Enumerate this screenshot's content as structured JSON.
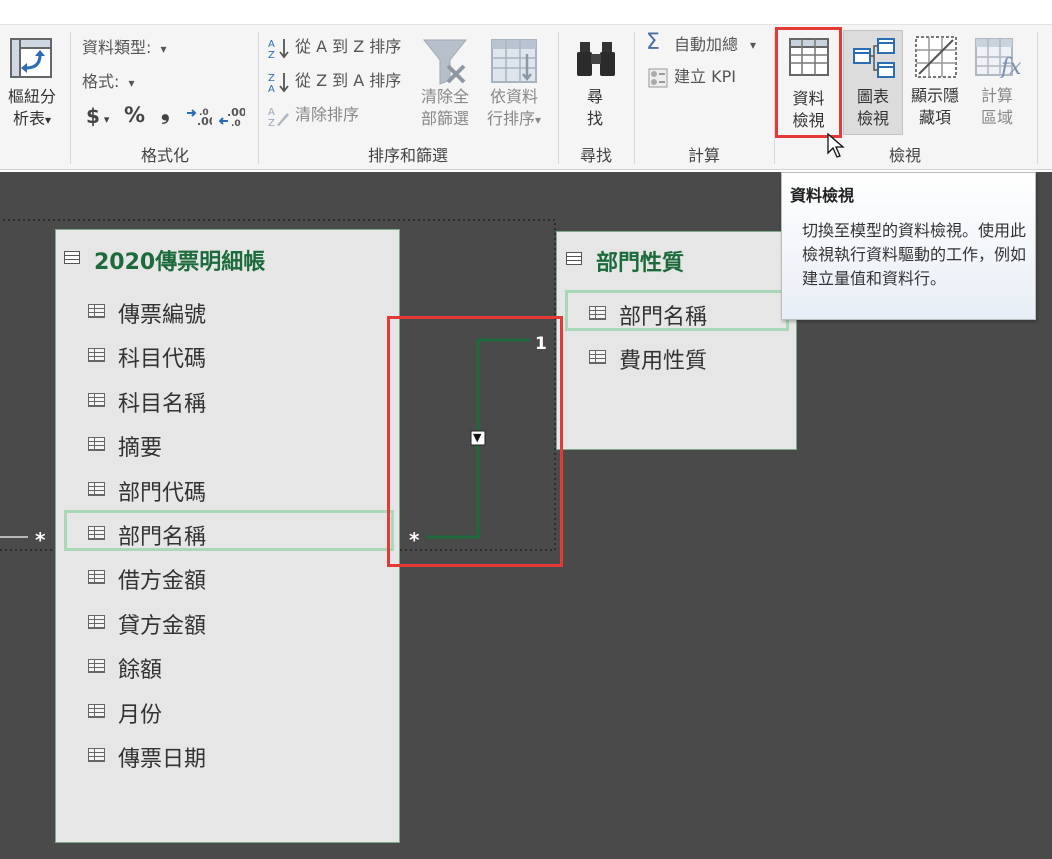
{
  "ribbon": {
    "pivot": {
      "label_line1": "樞紐分",
      "label_line2": "析表",
      "arrow": "▾"
    },
    "format": {
      "data_type": "資料類型:",
      "format": "格式:",
      "dropdown": "▾",
      "currency": "$",
      "percent": "%",
      "comma": "❟",
      "inc_decimal": "⁺.0  .00",
      "dec_decimal": ".00  .0",
      "group_label": "格式化"
    },
    "sort": {
      "sort_az": "從 A 到 Z 排序",
      "sort_za": "從 Z 到 A 排序",
      "clear_sort": "清除排序",
      "clear_filters_1": "清除全",
      "clear_filters_2": "部篩選",
      "sort_by_col_1": "依資料",
      "sort_by_col_2": "行排序",
      "sort_by_arrow": "▾",
      "group_label": "排序和篩選"
    },
    "find": {
      "label_1": "尋",
      "label_2": "找",
      "group_label": "尋找"
    },
    "calc": {
      "autosum": "自動加總",
      "autosum_arrow": "▾",
      "create_kpi": "建立 KPI",
      "group_label": "計算"
    },
    "view": {
      "data_view_1": "資料",
      "data_view_2": "檢視",
      "diagram_view_1": "圖表",
      "diagram_view_2": "檢視",
      "show_hidden_1": "顯示隱",
      "show_hidden_2": "藏項",
      "calc_area_1": "計算",
      "calc_area_2": "區域",
      "group_label": "檢視"
    }
  },
  "tooltip": {
    "title": "資料檢視",
    "body": "切換至模型的資料檢視。使用此檢視執行資料驅動的工作，例如建立量值和資料行。"
  },
  "tables": {
    "main": {
      "title": "2020傳票明細帳",
      "fields": [
        "傳票編號",
        "科目代碼",
        "科目名稱",
        "摘要",
        "部門代碼",
        "部門名稱",
        "借方金額",
        "貸方金額",
        "餘額",
        "月份",
        "傳票日期"
      ]
    },
    "dept": {
      "title": "部門性質",
      "fields": [
        "部門名稱",
        "費用性質"
      ]
    }
  },
  "relationship": {
    "many_marker": "*",
    "one_marker": "1",
    "left_many_marker": "*",
    "direction_arrow": "▼"
  },
  "colors": {
    "accent_green": "#1d6b3c",
    "highlight_red": "#e53935",
    "selected_field": "#a8d8b8",
    "canvas": "#4a4a4a"
  }
}
